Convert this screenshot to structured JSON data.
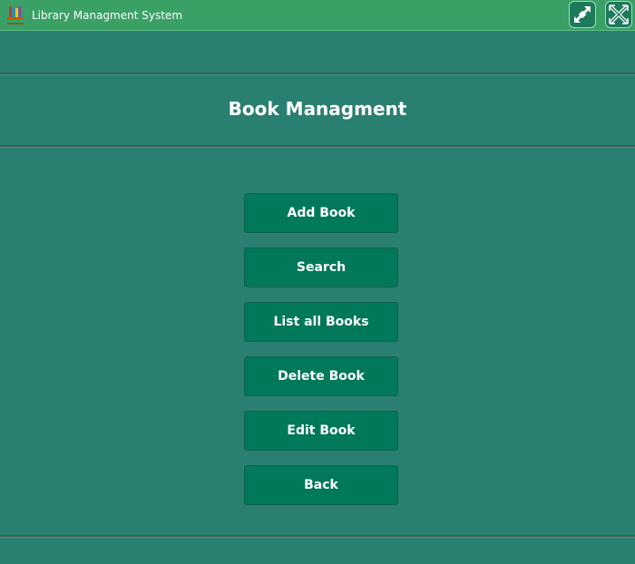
{
  "window": {
    "title": "Library Managment System",
    "app_icon": "books-stack-icon",
    "controls": [
      {
        "name": "restore-icon"
      },
      {
        "name": "close-icon"
      }
    ]
  },
  "page": {
    "title": "Book Managment"
  },
  "menu": {
    "add_book": "Add Book",
    "search": "Search",
    "list_all_books": "List all Books",
    "delete_book": "Delete Book",
    "edit_book": "Edit Book",
    "back": "Back"
  },
  "colors": {
    "titlebar": "#3aa066",
    "background": "#2a8070",
    "button": "#00785a",
    "text": "#ffffff"
  }
}
